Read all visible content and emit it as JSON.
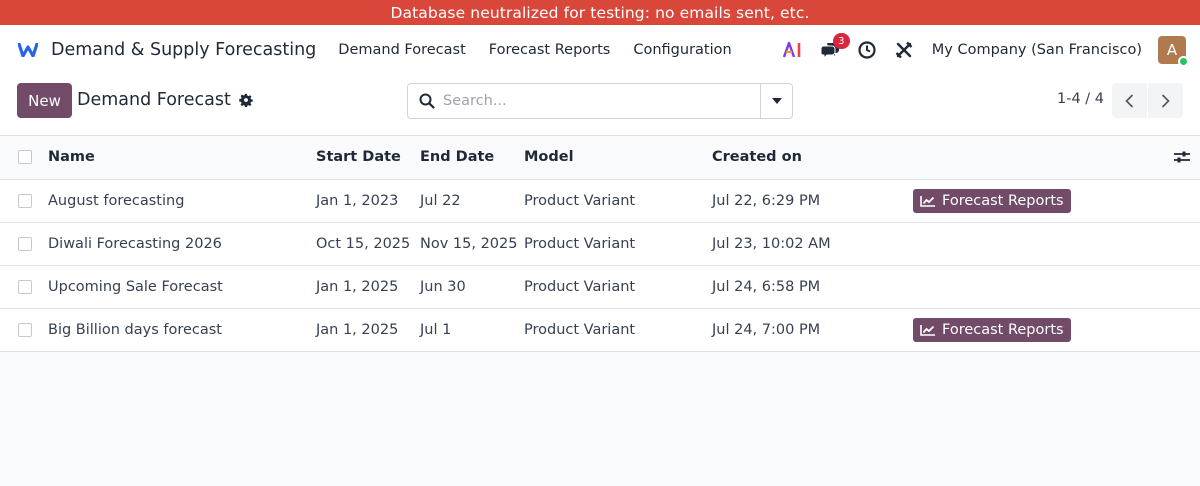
{
  "banner": {
    "text": "Database neutralized for testing: no emails sent, etc."
  },
  "navbar": {
    "app_name": "Demand & Supply Forecasting",
    "menus": [
      "Demand Forecast",
      "Forecast Reports",
      "Configuration"
    ],
    "message_count": "3",
    "company": "My Company (San Francisco)",
    "avatar_initial": "A"
  },
  "control_panel": {
    "new_label": "New",
    "title": "Demand Forecast",
    "search_placeholder": "Search...",
    "pager": "1-4 / 4"
  },
  "table": {
    "columns": [
      "Name",
      "Start Date",
      "End Date",
      "Model",
      "Created on"
    ],
    "rows": [
      {
        "name": "August forecasting",
        "start": "Jan 1, 2023",
        "end": "Jul 22",
        "model": "Product Variant",
        "created": "Jul 22, 6:29 PM",
        "action": "Forecast Reports"
      },
      {
        "name": "Diwali Forecasting 2026",
        "start": "Oct 15, 2025",
        "end": "Nov 15, 2025",
        "model": "Product Variant",
        "created": "Jul 23, 10:02 AM",
        "action": ""
      },
      {
        "name": "Upcoming Sale Forecast",
        "start": "Jan 1, 2025",
        "end": "Jun 30",
        "model": "Product Variant",
        "created": "Jul 24, 6:58 PM",
        "action": ""
      },
      {
        "name": "Big Billion days forecast",
        "start": "Jan 1, 2025",
        "end": "Jul 1",
        "model": "Product Variant",
        "created": "Jul 24, 7:00 PM",
        "action": "Forecast Reports"
      }
    ]
  },
  "colors": {
    "banner": "#d9473a",
    "primary": "#714b67",
    "badge": "#d7263d"
  }
}
